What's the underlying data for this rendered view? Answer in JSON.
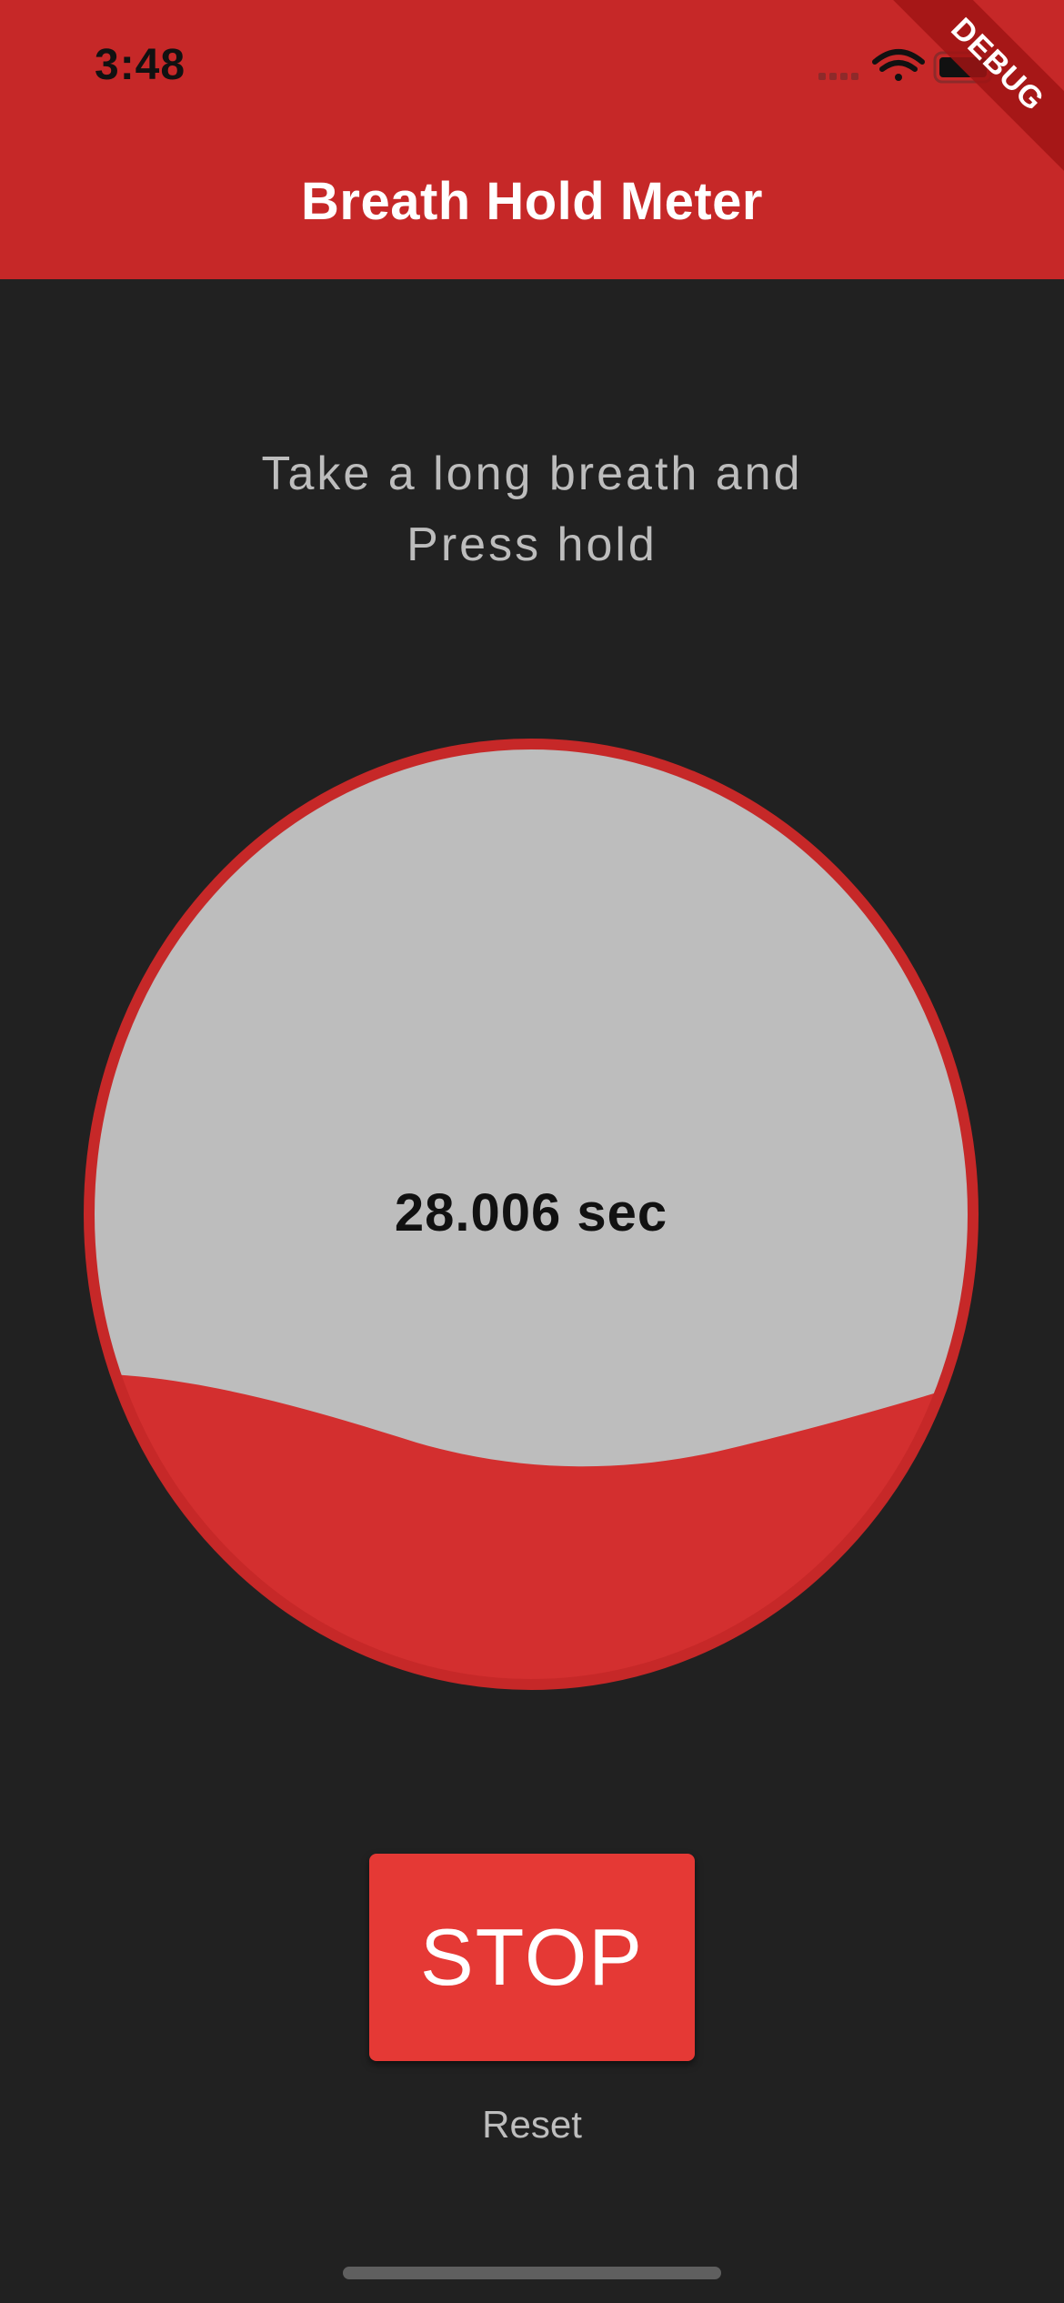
{
  "status_bar": {
    "time": "3:48"
  },
  "app_bar": {
    "title": "Breath Hold Meter",
    "debug_label": "DEBUG"
  },
  "instruction": {
    "line1": "Take a long breath and",
    "line2": "Press hold"
  },
  "gauge": {
    "value_text": "28.006 sec",
    "fill_fraction": 0.27,
    "fill_color": "#d32f2f",
    "background_color": "#bdbdbd",
    "border_color": "#c62828"
  },
  "actions": {
    "stop_label": "STOP",
    "reset_label": "Reset"
  },
  "colors": {
    "app_bar": "#c62828",
    "page_background": "#212121",
    "button": "#e53935"
  }
}
